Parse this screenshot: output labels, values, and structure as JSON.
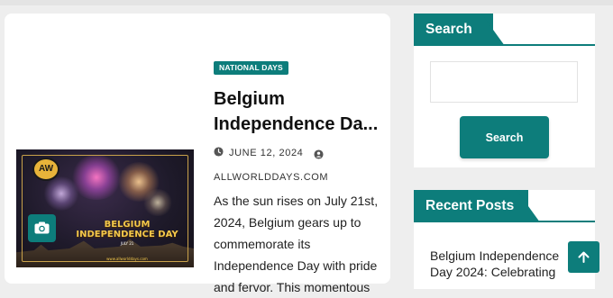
{
  "article": {
    "category": "NATIONAL DAYS",
    "title": "Belgium Independence Da...",
    "date": "JUNE 12, 2024",
    "author": "ALLWORLDDAYS.COM",
    "excerpt": "As the sun rises on July 21st, 2024, Belgium gears up to commemorate its Independence Day with pride and fervor. This momentous",
    "thumbnail": {
      "logo_text": "AW",
      "title_line1": "BELGIUM",
      "title_line2": "INDEPENDENCE DAY",
      "date_text": "JULY 21",
      "url_text": "www.allworlddays.com"
    },
    "camera_icon": "camera-icon"
  },
  "sidebar": {
    "search_widget": {
      "title": "Search",
      "input_placeholder": "",
      "button_label": "Search"
    },
    "recent_widget": {
      "title": "Recent Posts",
      "items": [
        {
          "label": "Belgium Independence Day 2024: Celebrating"
        }
      ]
    }
  },
  "scroll_top_icon": "chevron-up-icon",
  "colors": {
    "accent": "#0d7d7b",
    "background": "#eeeeee",
    "card": "#ffffff"
  }
}
